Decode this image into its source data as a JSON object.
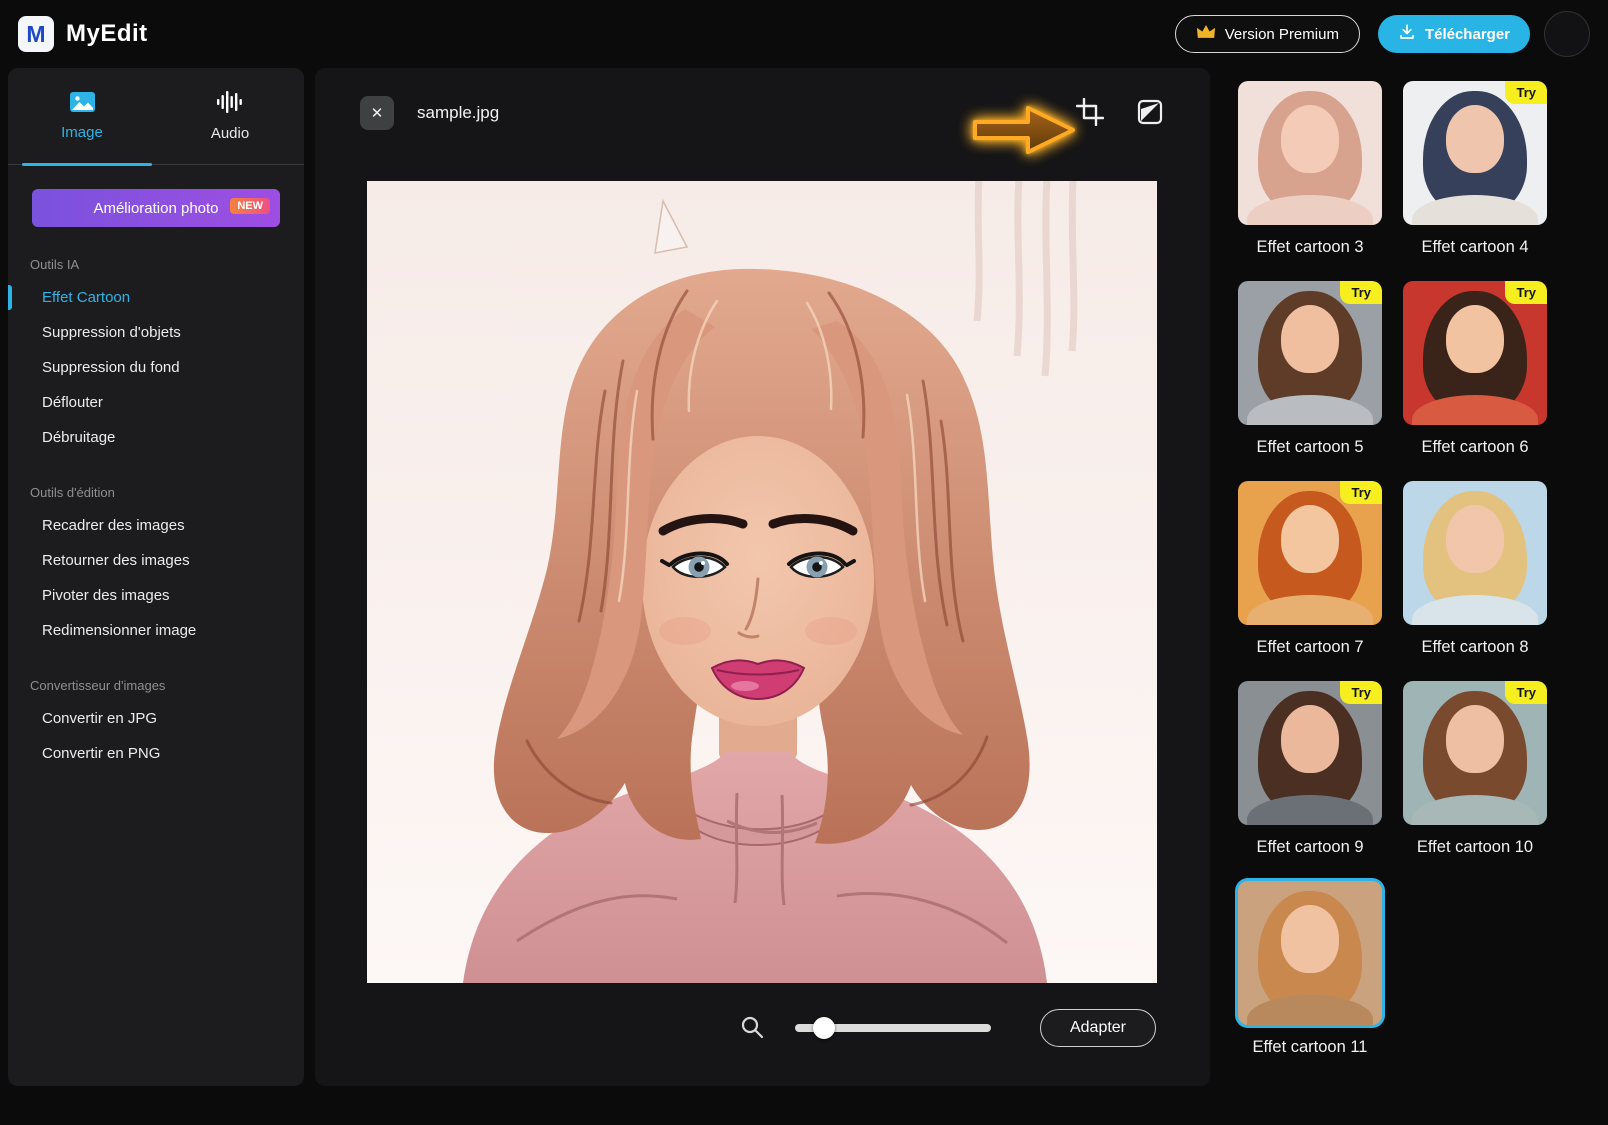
{
  "app": {
    "name": "MyEdit",
    "logo_letter": "M"
  },
  "header": {
    "premium_label": "Version Premium",
    "download_label": "Télécharger"
  },
  "sidebar": {
    "tabs": [
      {
        "label": "Image",
        "active": true
      },
      {
        "label": "Audio",
        "active": false
      }
    ],
    "enhance": {
      "label": "Amélioration photo",
      "badge": "NEW"
    },
    "sections": [
      {
        "title": "Outils IA",
        "items": [
          "Effet Cartoon",
          "Suppression d'objets",
          "Suppression du fond",
          "Déflouter",
          "Débruitage"
        ]
      },
      {
        "title": "Outils d'édition",
        "items": [
          "Recadrer des images",
          "Retourner des images",
          "Pivoter des images",
          "Redimensionner image"
        ]
      },
      {
        "title": "Convertisseur d'images",
        "items": [
          "Convertir en JPG",
          "Convertir en PNG"
        ]
      }
    ],
    "active_item": "Effet Cartoon"
  },
  "canvas": {
    "filename": "sample.jpg",
    "close_glyph": "✕",
    "fit_button": "Adapter"
  },
  "effects": {
    "try_badge": "Try",
    "selected": "Effet cartoon 11",
    "items": [
      {
        "label": "Effet cartoon 3",
        "try": false
      },
      {
        "label": "Effet cartoon 4",
        "try": true
      },
      {
        "label": "Effet cartoon 5",
        "try": true
      },
      {
        "label": "Effet cartoon 6",
        "try": true
      },
      {
        "label": "Effet cartoon 7",
        "try": true
      },
      {
        "label": "Effet cartoon 8",
        "try": false
      },
      {
        "label": "Effet cartoon 9",
        "try": true
      },
      {
        "label": "Effet cartoon 10",
        "try": true
      },
      {
        "label": "Effet cartoon 11",
        "try": false,
        "selected": true
      }
    ]
  },
  "colors": {
    "accent": "#2eb3e6",
    "download_button": "#29b4e6",
    "try_badge": "#f6ee1e",
    "enhance_gradient": [
      "#7a52dd",
      "#9e4ee2"
    ],
    "new_badge_gradient": [
      "#f5823c",
      "#ee4f86"
    ],
    "annotation_arrow": "#ffaa22"
  }
}
